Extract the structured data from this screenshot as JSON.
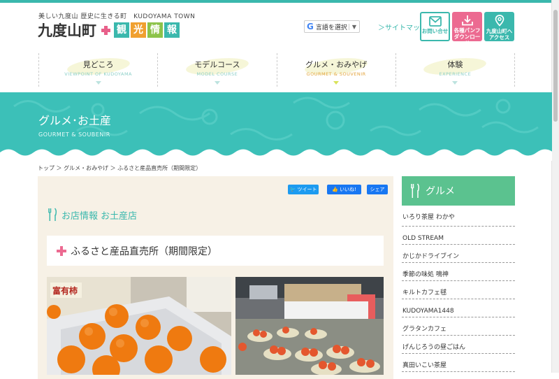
{
  "header": {
    "tagline": "美しい九度山 歴史に生きる町　KUDOYAMA TOWN",
    "logo_text": "九度山町",
    "logo_chars": [
      "観",
      "光",
      "情",
      "報"
    ],
    "logo_colors": [
      "#3bb8ad",
      "#f0a030",
      "#8cc34a",
      "#3bb8ad"
    ],
    "translate_label": "言語を選択",
    "sitemap_label": "＞サイトマップ",
    "contact_label": "お問い合せ",
    "pamphlet_label_1": "各種パンフ",
    "pamphlet_label_2": "ダウンロード",
    "access_label_1": "九度山町へ",
    "access_label_2": "アクセス"
  },
  "nav": [
    {
      "jp": "見どころ",
      "en": "VIEWPOINT OF KUDOYAMA"
    },
    {
      "jp": "モデルコース",
      "en": "MODEL COURSE"
    },
    {
      "jp": "グルメ・おみやげ",
      "en": "GOURMET & SOUVENIR"
    },
    {
      "jp": "体験",
      "en": "EXPERIENCE"
    }
  ],
  "hero": {
    "title": "グルメ･お土産",
    "subtitle": "GOURMET & SOUBENIR"
  },
  "breadcrumb": "トップ ＞ グルメ・おみやげ ＞ ふるさと産品直売所（期間限定）",
  "share": {
    "tweet": "ツイート",
    "like": "いいね!",
    "share": "シェア"
  },
  "article": {
    "category": "お店情報 お土産店",
    "title": "ふるさと産品直売所（期間限定）",
    "photo1_label": "富有柿"
  },
  "sidebar": {
    "heading": "グルメ",
    "items": [
      "いろり茶屋 わかや",
      "OLD STREAM",
      "かじかドライブイン",
      "季節の味処 鳴神",
      "キルトカフェ毬",
      "KUDOYAMA1448",
      "グラタンカフェ",
      "げんじろうの昼ごはん",
      "真田いこい茶屋"
    ]
  },
  "colors": {
    "accent": "#3bb8ad",
    "pink": "#ec6a91",
    "sidebar_head": "#5bc28f",
    "content_bg": "#f7f1e6"
  }
}
